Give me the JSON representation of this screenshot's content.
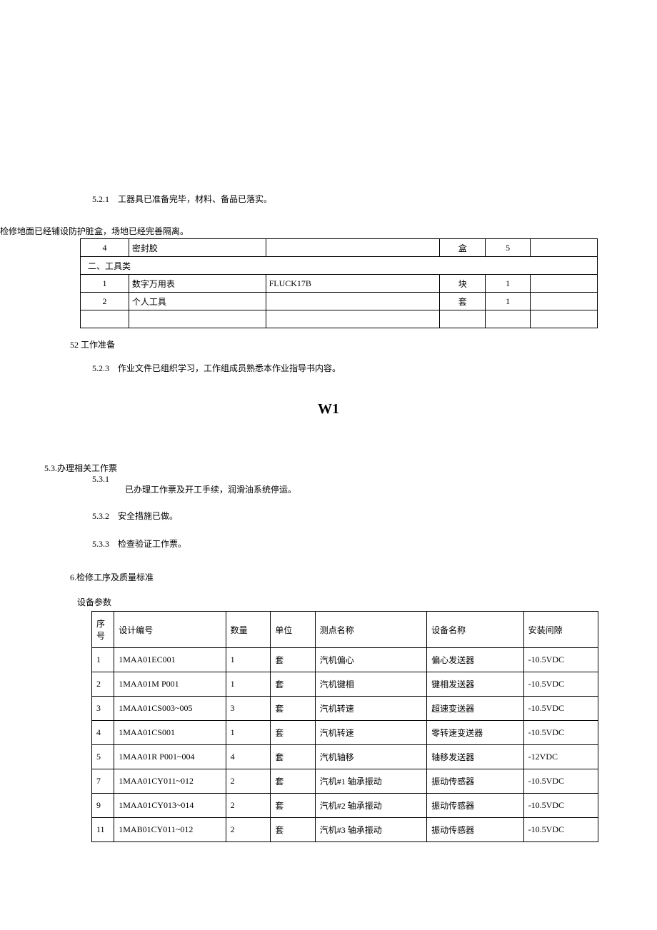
{
  "lines": {
    "l521": "5.2.1　工器具已准备完毕，材料、备品已落实。",
    "overlap": "检修地面已经铺设防护脏盒，场地已经完善隔离。",
    "l52": "52 工作准备",
    "l523": "5.2.3　作业文件已组织学习，工作组成员熟悉本作业指导书内容。",
    "w1": "W1",
    "l53": "5.3.办理相关工作票",
    "l531a": "5.3.1",
    "l531b": "已办理工作票及开工手续，润滑油系统停运。",
    "l532": "5.3.2　安全措施已做。",
    "l533": "5.3.3　检查验证工作票。",
    "l6": "6.检修工序及质量标准",
    "params": "设备参数"
  },
  "table1": {
    "rows": [
      {
        "a": "4",
        "b": "密封胶",
        "c": "",
        "d": "盒",
        "e": "5",
        "f": ""
      }
    ],
    "section2": "二、工具类",
    "rows2": [
      {
        "a": "1",
        "b": "数字万用表",
        "c": "FLUCK17B",
        "d": "块",
        "e": "1",
        "f": ""
      },
      {
        "a": "2",
        "b": "个人工具",
        "c": "",
        "d": "套",
        "e": "1",
        "f": ""
      },
      {
        "a": "",
        "b": "",
        "c": "",
        "d": "",
        "e": "",
        "f": ""
      }
    ]
  },
  "table2": {
    "headers": {
      "h1": "序号",
      "h2": "设计编号",
      "h3": "数量",
      "h4": "单位",
      "h5": "测点名称",
      "h6": "设备名称",
      "h7": "安装间隙"
    },
    "rows": [
      {
        "c1": "1",
        "c2": "1MAA01EC001",
        "c3": "1",
        "c4": "套",
        "c5": "汽机偏心",
        "c6": "偏心发送器",
        "c7": "-10.5VDC"
      },
      {
        "c1": "2",
        "c2": "1MAA01M P001",
        "c3": "1",
        "c4": "套",
        "c5": "汽机键相",
        "c6": "键相发送器",
        "c7": "-10.5VDC"
      },
      {
        "c1": "3",
        "c2": "1MAA01CS003~005",
        "c3": "3",
        "c4": "套",
        "c5": "汽机转速",
        "c6": "超速变送器",
        "c7": "-10.5VDC"
      },
      {
        "c1": "4",
        "c2": "1MAA01CS001",
        "c3": "1",
        "c4": "套",
        "c5": "汽机转速",
        "c6": "零转速变送器",
        "c7": "-10.5VDC"
      },
      {
        "c1": "5",
        "c2": "1MAA01R P001~004",
        "c3": "4",
        "c4": "套",
        "c5": "汽机轴移",
        "c6": "轴移发送器",
        "c7": "-12VDC"
      },
      {
        "c1": "7",
        "c2": "1MAA01CY011~012",
        "c3": "2",
        "c4": "套",
        "c5": "汽机#1 轴承振动",
        "c6": "振动传感器",
        "c7": "-10.5VDC"
      },
      {
        "c1": "9",
        "c2": "1MAA01CY013~014",
        "c3": "2",
        "c4": "套",
        "c5": "汽机#2 轴承振动",
        "c6": "振动传感器",
        "c7": "-10.5VDC"
      },
      {
        "c1": "11",
        "c2": "1MAB01CY011~012",
        "c3": "2",
        "c4": "套",
        "c5": "汽机#3 轴承振动",
        "c6": "振动传感器",
        "c7": "-10.5VDC"
      }
    ]
  }
}
